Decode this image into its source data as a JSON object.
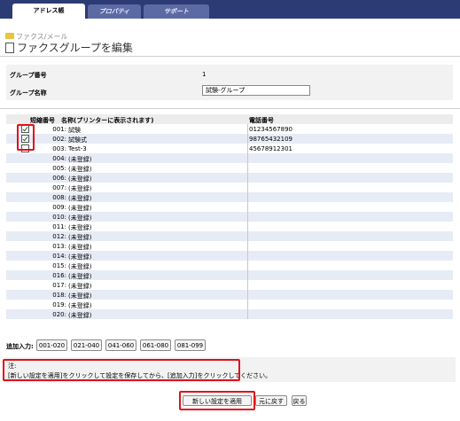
{
  "tabs": [
    {
      "label": "アドレス帳"
    },
    {
      "label": "プロパティ"
    },
    {
      "label": "サポート"
    }
  ],
  "breadcrumb": "ファクス/メール",
  "page_title": "ファクスグループを編集",
  "info": {
    "group_number_label": "グループ番号",
    "group_number_value": "1",
    "group_name_label": "グループ名称",
    "group_name_value": "試験-グループ"
  },
  "list": {
    "header": {
      "speed_dial": "短縮番号",
      "name": "名称(プリンターに表示されます)",
      "phone": "電話番号"
    },
    "rows": [
      {
        "num": "001:",
        "name": "試験",
        "phone": "01234567890",
        "checked": true
      },
      {
        "num": "002:",
        "name": "試験式",
        "phone": "98765432109",
        "checked": true
      },
      {
        "num": "003:",
        "name": "Test-3",
        "phone": "45678912301",
        "checked": false
      },
      {
        "num": "004:",
        "name": "(未登録)",
        "phone": ""
      },
      {
        "num": "005:",
        "name": "(未登録)",
        "phone": ""
      },
      {
        "num": "006:",
        "name": "(未登録)",
        "phone": ""
      },
      {
        "num": "007:",
        "name": "(未登録)",
        "phone": ""
      },
      {
        "num": "008:",
        "name": "(未登録)",
        "phone": ""
      },
      {
        "num": "009:",
        "name": "(未登録)",
        "phone": ""
      },
      {
        "num": "010:",
        "name": "(未登録)",
        "phone": ""
      },
      {
        "num": "011:",
        "name": "(未登録)",
        "phone": ""
      },
      {
        "num": "012:",
        "name": "(未登録)",
        "phone": ""
      },
      {
        "num": "013:",
        "name": "(未登録)",
        "phone": ""
      },
      {
        "num": "014:",
        "name": "(未登録)",
        "phone": ""
      },
      {
        "num": "015:",
        "name": "(未登録)",
        "phone": ""
      },
      {
        "num": "016:",
        "name": "(未登録)",
        "phone": ""
      },
      {
        "num": "017:",
        "name": "(未登録)",
        "phone": ""
      },
      {
        "num": "018:",
        "name": "(未登録)",
        "phone": ""
      },
      {
        "num": "019:",
        "name": "(未登録)",
        "phone": ""
      },
      {
        "num": "020:",
        "name": "(未登録)",
        "phone": ""
      }
    ]
  },
  "additional_input": {
    "label": "追加入力:",
    "buttons": [
      "001-020",
      "021-040",
      "041-060",
      "061-080",
      "081-099"
    ]
  },
  "note": {
    "title": "注:",
    "text": "[新しい設定を適用]をクリックして設定を保存してから、[追加入力]をクリックしてください。"
  },
  "actions": {
    "apply": "新しい設定を適用",
    "restore": "元に戻す",
    "back": "戻る"
  },
  "colors": {
    "topbar": "#2c3b74",
    "highlight": "#e0101a",
    "row_alt": "#e7ebf5"
  }
}
